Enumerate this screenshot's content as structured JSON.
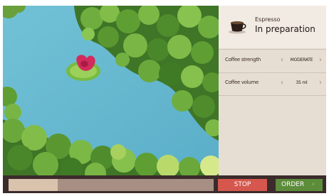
{
  "product": {
    "name": "Espresso",
    "status": "In preparation",
    "icon": "coffee-cup-icon"
  },
  "settings": [
    {
      "label": "Coffee strength",
      "value": "MODERATE"
    },
    {
      "label": "Coffee volume",
      "value": "35 ml"
    }
  ],
  "arrows": {
    "left": "‹",
    "right": "›"
  },
  "progress": {
    "fraction": 0.24
  },
  "actions": {
    "stop_label": "STOP",
    "order_label": "ORDER",
    "order_chevron": "›"
  },
  "colors": {
    "stop": "#d5574d",
    "order": "#5d8c3b",
    "panel": "#e7ded3",
    "bar": "#3b2b2b"
  }
}
